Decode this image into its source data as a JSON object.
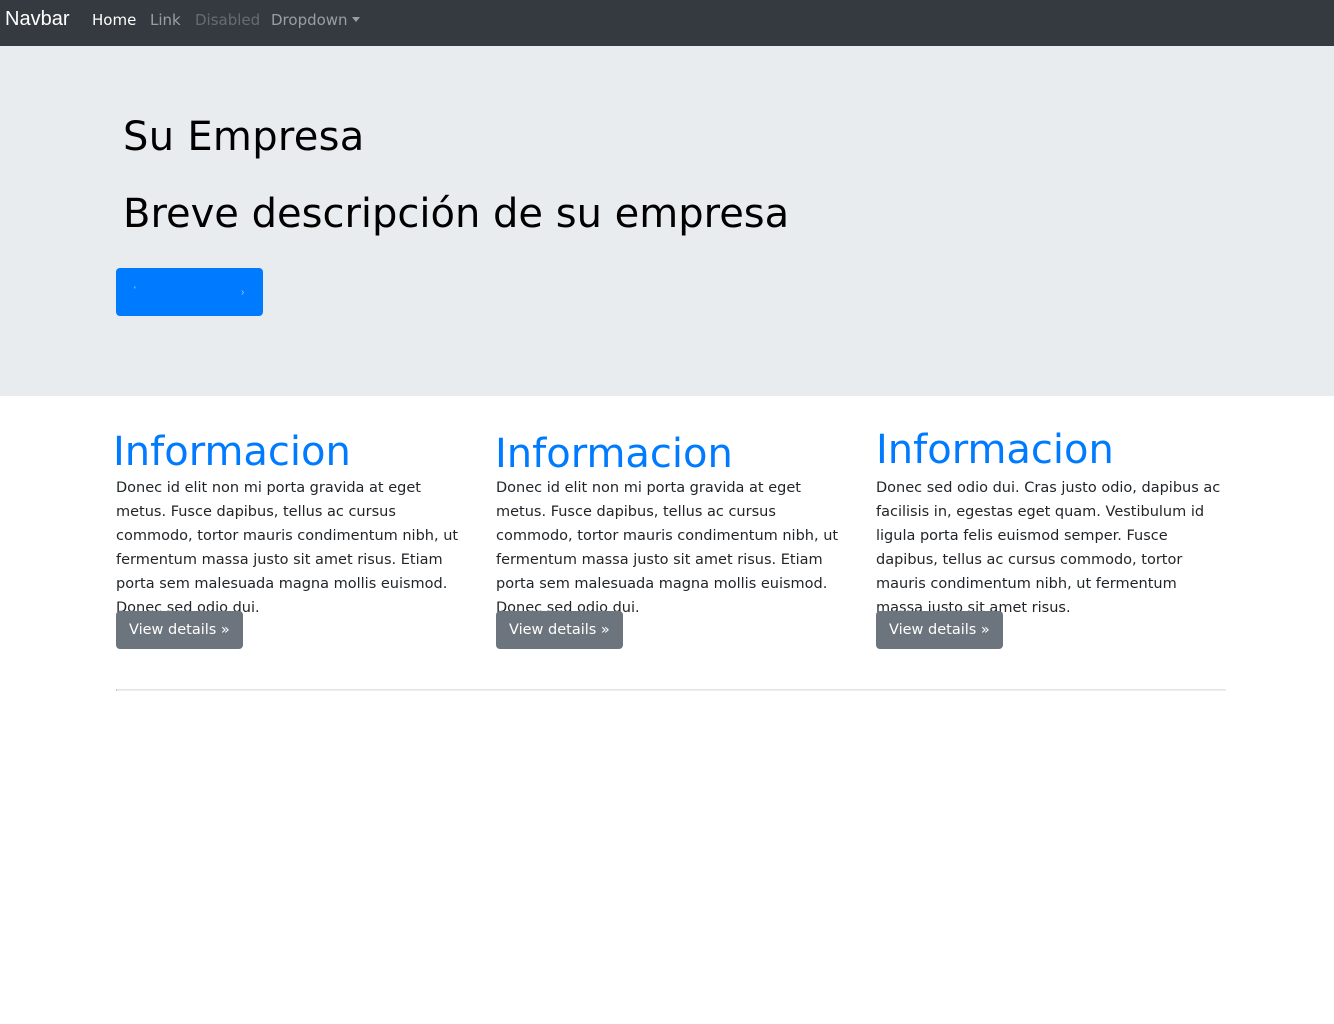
{
  "navbar": {
    "brand": "Navbar",
    "items": [
      {
        "label": "Home",
        "state": "active"
      },
      {
        "label": "Link",
        "state": "normal"
      },
      {
        "label": "Disabled",
        "state": "disabled"
      },
      {
        "label": "Dropdown",
        "state": "normal",
        "has_caret": true
      }
    ]
  },
  "jumbotron": {
    "title": "Su Empresa",
    "subtitle": "Breve descripción de su empresa",
    "button": {
      "left_glyph": "'",
      "right_glyph": "›"
    }
  },
  "columns": [
    {
      "heading": "Informacion",
      "text": "Donec id elit non mi porta gravida at eget metus. Fusce dapibus, tellus ac cursus commodo, tortor mauris condimentum nibh, ut fermentum massa justo sit amet risus. Etiam porta sem malesuada magna mollis euismod. Donec sed odio dui.",
      "button_label": "View details »"
    },
    {
      "heading": "Informacion",
      "text": "Donec id elit non mi porta gravida at eget metus. Fusce dapibus, tellus ac cursus commodo, tortor mauris condimentum nibh, ut fermentum massa justo sit amet risus. Etiam porta sem malesuada magna mollis euismod. Donec sed odio dui.",
      "button_label": "View details »"
    },
    {
      "heading": "Informacion",
      "text": "Donec sed odio dui. Cras justo odio, dapibus ac facilisis in, egestas eget quam. Vestibulum id ligula porta felis euismod semper. Fusce dapibus, tellus ac cursus commodo, tortor mauris condimentum nibh, ut fermentum massa justo sit amet risus.",
      "button_label": "View details »"
    }
  ],
  "colors": {
    "navbar_bg": "#343a40",
    "jumbotron_bg": "#e9ecef",
    "primary": "#007bff",
    "secondary": "#6c757d",
    "text": "#212529"
  }
}
